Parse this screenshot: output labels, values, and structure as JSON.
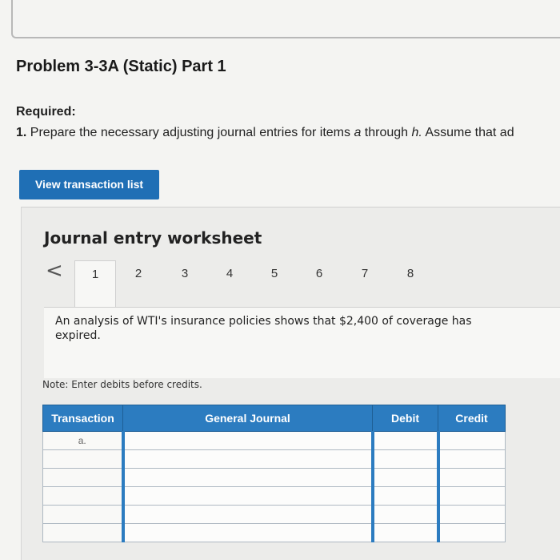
{
  "header": {
    "problem_title": "Problem 3-3A (Static) Part 1"
  },
  "instructions": {
    "required_label": "Required:",
    "item_number": "1.",
    "item_text_before": "Prepare the necessary adjusting journal entries for items ",
    "item_italic_a": "a",
    "item_text_middle": " through ",
    "item_italic_h": "h.",
    "item_text_after": " Assume that ad"
  },
  "buttons": {
    "view_transaction_list": "View transaction list"
  },
  "worksheet": {
    "title": "Journal entry worksheet",
    "prev_glyph": "<",
    "tabs": [
      "1",
      "2",
      "3",
      "4",
      "5",
      "6",
      "7",
      "8"
    ],
    "active_tab": "1",
    "description": "An analysis of WTI's insurance policies shows that $2,400 of coverage has expired.",
    "note": "Note: Enter debits before credits."
  },
  "journal_table": {
    "headers": {
      "transaction": "Transaction",
      "general_journal": "General Journal",
      "debit": "Debit",
      "credit": "Credit"
    },
    "rows": [
      {
        "transaction": "a.",
        "general_journal": "",
        "debit": "",
        "credit": ""
      },
      {
        "transaction": "",
        "general_journal": "",
        "debit": "",
        "credit": ""
      },
      {
        "transaction": "",
        "general_journal": "",
        "debit": "",
        "credit": ""
      },
      {
        "transaction": "",
        "general_journal": "",
        "debit": "",
        "credit": ""
      },
      {
        "transaction": "",
        "general_journal": "",
        "debit": "",
        "credit": ""
      },
      {
        "transaction": "",
        "general_journal": "",
        "debit": "",
        "credit": ""
      }
    ]
  },
  "colors": {
    "accent_blue": "#1f6fb5",
    "table_header_blue": "#2c7cc0"
  }
}
